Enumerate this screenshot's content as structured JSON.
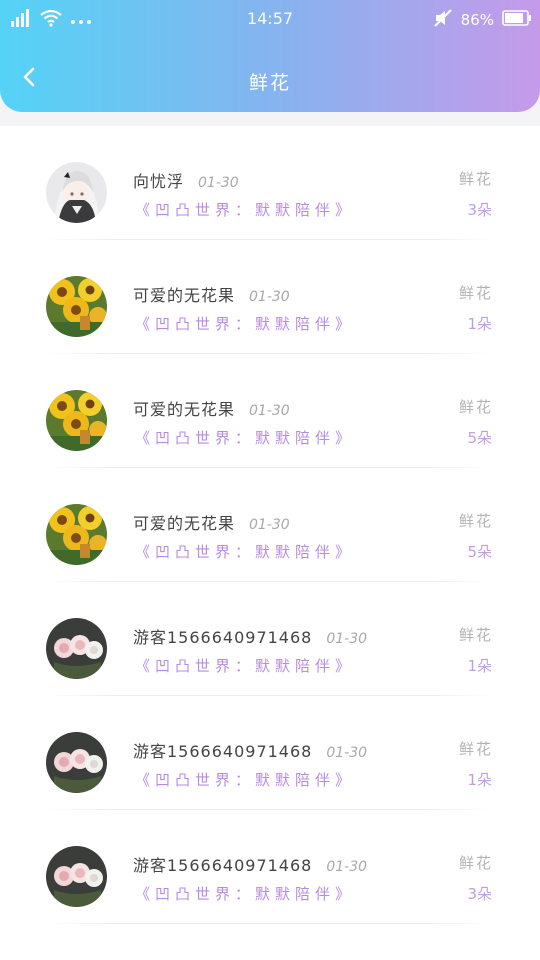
{
  "status_bar": {
    "time": "14:57",
    "battery": "86%"
  },
  "header": {
    "title": "鲜花",
    "back_icon": "chevron-left-icon"
  },
  "colors": {
    "header_gradient_start": "#54d3f6",
    "header_gradient_end": "#c59aea",
    "message_purple": "#b98be0",
    "date_gray": "#a9a9a9"
  },
  "list": [
    {
      "name": "向忧浮",
      "date": "01-30",
      "message": "《凹凸世界：默默陪伴》",
      "gift": "鲜花",
      "count": "3朵",
      "avatar": "anime"
    },
    {
      "name": "可爱的无花果",
      "date": "01-30",
      "message": "《凹凸世界：默默陪伴》",
      "gift": "鲜花",
      "count": "1朵",
      "avatar": "sunflower"
    },
    {
      "name": "可爱的无花果",
      "date": "01-30",
      "message": "《凹凸世界：默默陪伴》",
      "gift": "鲜花",
      "count": "5朵",
      "avatar": "sunflower"
    },
    {
      "name": "可爱的无花果",
      "date": "01-30",
      "message": "《凹凸世界：默默陪伴》",
      "gift": "鲜花",
      "count": "5朵",
      "avatar": "sunflower"
    },
    {
      "name": "游客1566640971468",
      "date": "01-30",
      "message": "《凹凸世界：默默陪伴》",
      "gift": "鲜花",
      "count": "1朵",
      "avatar": "roses"
    },
    {
      "name": "游客1566640971468",
      "date": "01-30",
      "message": "《凹凸世界：默默陪伴》",
      "gift": "鲜花",
      "count": "1朵",
      "avatar": "roses"
    },
    {
      "name": "游客1566640971468",
      "date": "01-30",
      "message": "《凹凸世界：默默陪伴》",
      "gift": "鲜花",
      "count": "3朵",
      "avatar": "roses"
    }
  ]
}
